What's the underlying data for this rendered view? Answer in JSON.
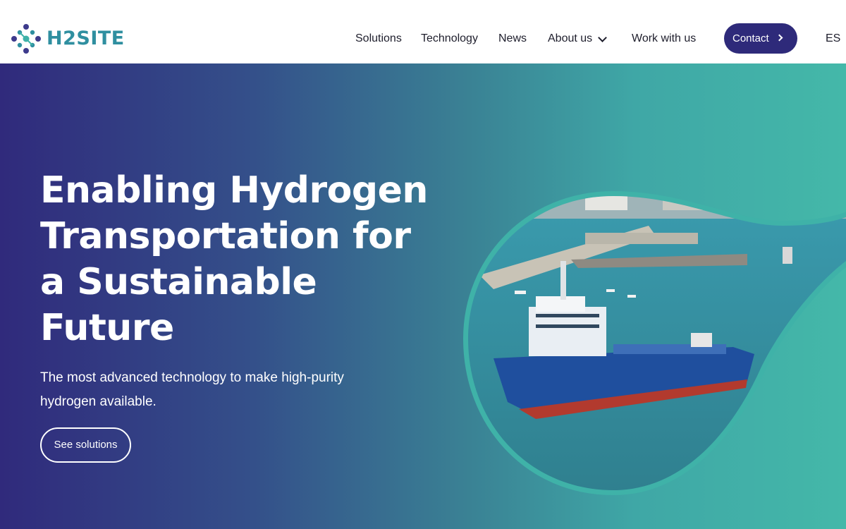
{
  "brand": {
    "name": "H2SITE",
    "colors": {
      "primary": "#2e2a7a",
      "teal": "#3fb2a8",
      "logo_blue": "#2f8fa0"
    }
  },
  "nav": {
    "items": [
      "Solutions",
      "Technology",
      "News",
      "About us",
      "Work with us"
    ],
    "contact_label": "Contact",
    "language": "ES"
  },
  "hero": {
    "title": "Enabling Hydrogen Transportation for a Sustainable Future",
    "subtitle": "The most advanced technology to make high-purity hydrogen available.",
    "cta_label": "See solutions",
    "image_description_icon": "ship-harbor-photo"
  }
}
